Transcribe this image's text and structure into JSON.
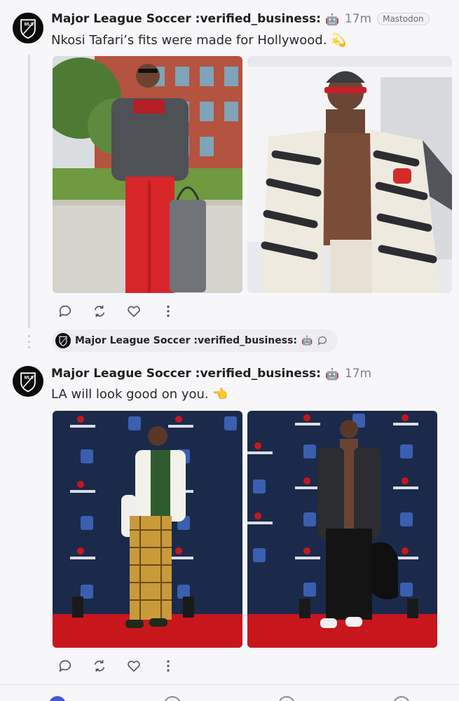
{
  "posts": [
    {
      "author": "Major League Soccer :verified_business:",
      "bot_badge": "🤖",
      "time": "17m",
      "source": "Mastodon",
      "text": "Nkosi Tafari’s fits were made for Hollywood.",
      "emoji": "💫",
      "images": [
        {
          "icon": "street-photo-grey-sweater-red-pants"
        },
        {
          "icon": "street-photo-zebra-cardigan"
        }
      ]
    },
    {
      "author": "Major League Soccer :verified_business:",
      "bot_badge": "🤖",
      "time": "17m",
      "text": "LA will look good on you.",
      "emoji": "👈",
      "images": [
        {
          "icon": "red-carpet-photo-south-africa-jersey"
        },
        {
          "icon": "red-carpet-photo-striped-jacket"
        }
      ]
    }
  ],
  "reply_chip": {
    "author": "Major League Soccer :verified_business:",
    "bot_badge": "🤖"
  },
  "colors": {
    "background": "#f7f7fa",
    "accent": "#3b5bdb",
    "muted": "#80808a",
    "sponsor_backdrop": "#1b2a4a",
    "carpet": "#c8161d"
  }
}
